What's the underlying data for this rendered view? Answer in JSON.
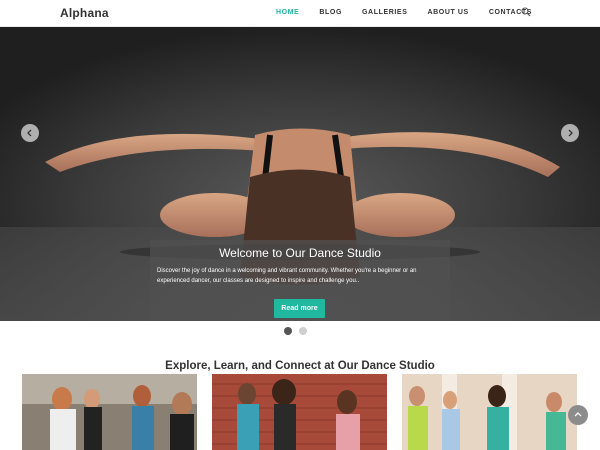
{
  "site": {
    "logo": "Alphana"
  },
  "nav": {
    "items": [
      {
        "label": "HOME",
        "active": true
      },
      {
        "label": "BLOG",
        "active": false
      },
      {
        "label": "GALLERIES",
        "active": false
      },
      {
        "label": "ABOUT US",
        "active": false
      },
      {
        "label": "CONTACTS",
        "active": false
      }
    ],
    "search_icon": "search-icon"
  },
  "hero": {
    "title": "Welcome to Our Dance Studio",
    "text": "Discover the joy of dance in a welcoming and vibrant community. Whether you're a beginner or an experienced dancer, our classes are designed to inspire and challenge you..",
    "button_label": "Read more",
    "prev_icon": "chevron-left-icon",
    "next_icon": "chevron-right-icon",
    "slides_count": 2,
    "active_slide": 1
  },
  "section": {
    "title": "Explore, Learn, and Connect at Our Dance Studio"
  },
  "colors": {
    "accent": "#20b89e",
    "text": "#333333"
  }
}
